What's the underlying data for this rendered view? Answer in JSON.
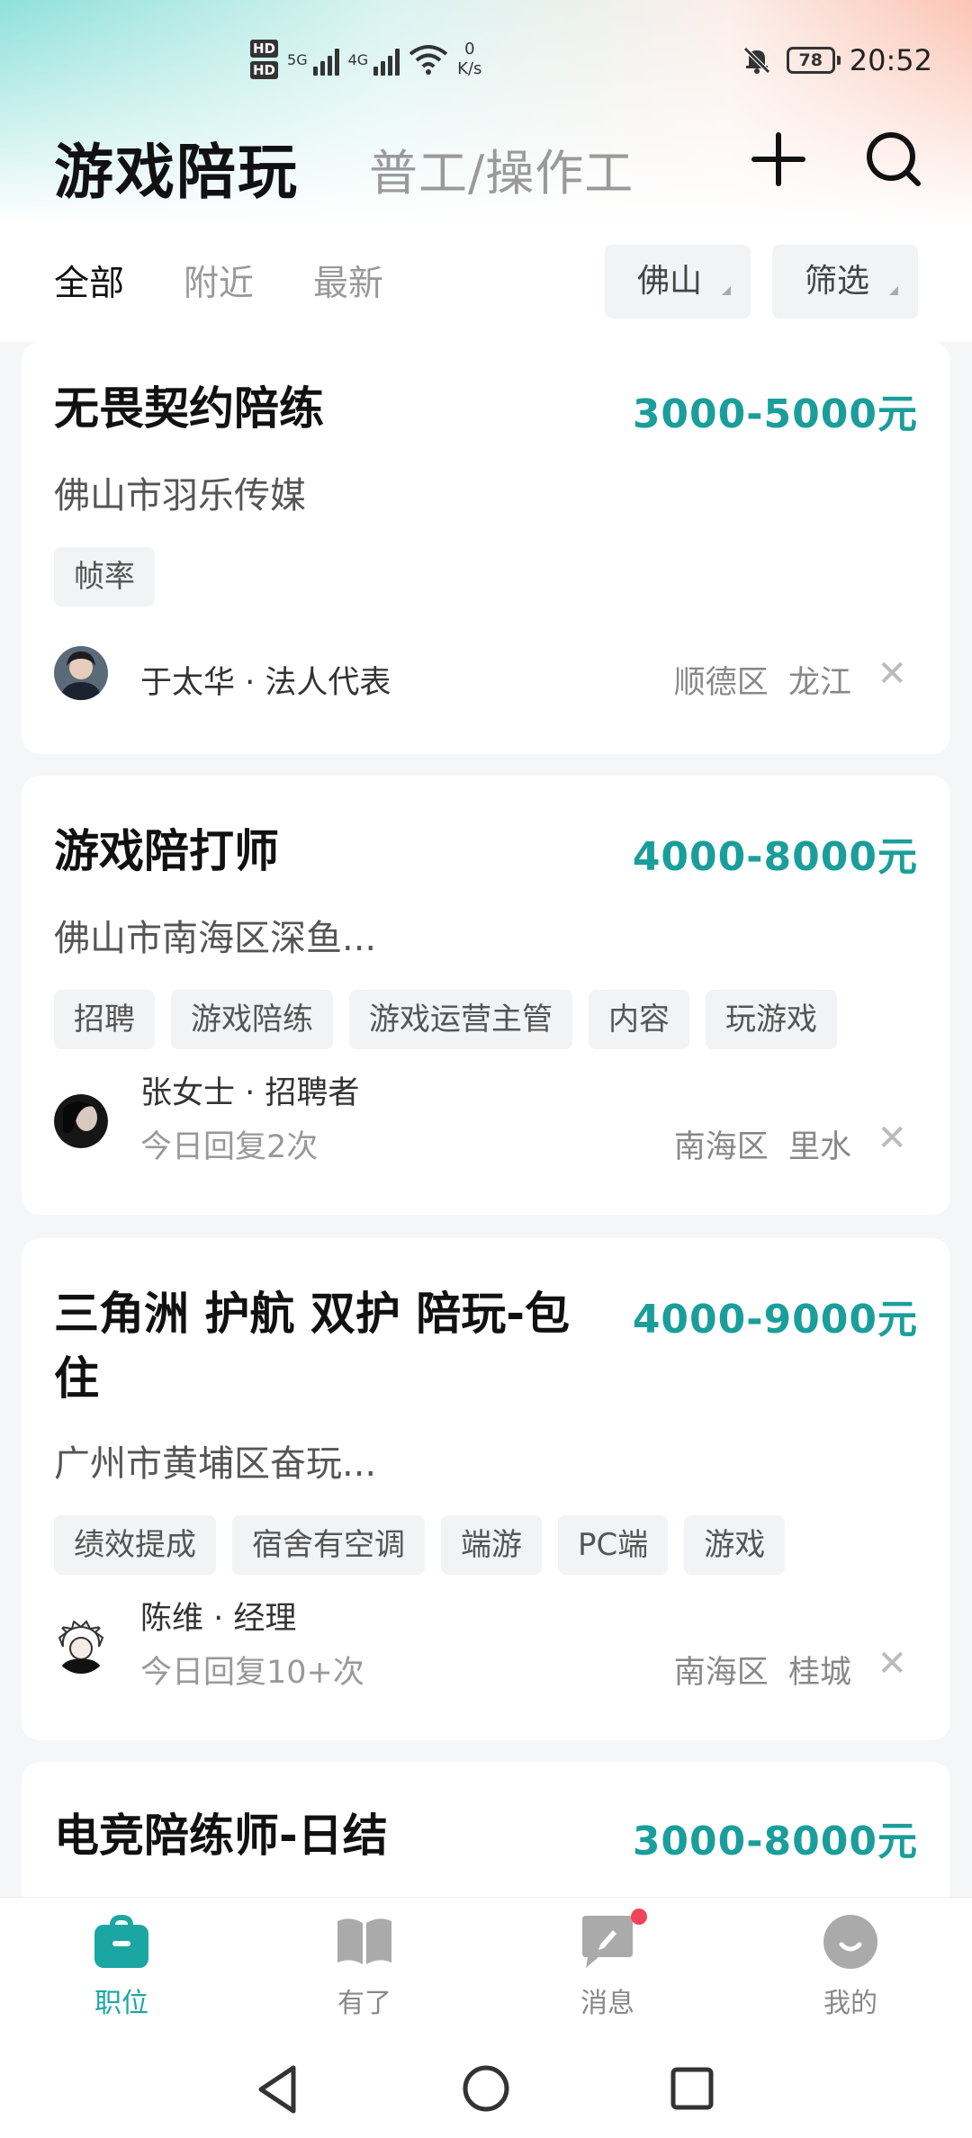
{
  "status_bar": {
    "hd1": "HD",
    "hd2": "HD",
    "net1": "5G",
    "net2": "4G",
    "speed_value": "0",
    "speed_unit": "K/s",
    "battery": "78",
    "time": "20:52"
  },
  "header": {
    "title": "游戏陪玩",
    "subtitle": "普工/操作工",
    "add_icon": "plus-icon",
    "search_icon": "search-icon"
  },
  "filters": {
    "tabs": [
      {
        "label": "全部",
        "active": true
      },
      {
        "label": "附近",
        "active": false
      },
      {
        "label": "最新",
        "active": false
      }
    ],
    "city": "佛山",
    "filter": "筛选"
  },
  "jobs": [
    {
      "title": "无畏契约陪练",
      "salary": "3000-5000元",
      "company": "佛山市羽乐传媒",
      "tags": [
        "帧率"
      ],
      "recruiter": "于太华 · 法人代表",
      "reply": "",
      "district": "顺德区",
      "area": "龙江"
    },
    {
      "title": "游戏陪打师",
      "salary": "4000-8000元",
      "company": "佛山市南海区深鱼...",
      "tags": [
        "招聘",
        "游戏陪练",
        "游戏运营主管",
        "内容",
        "玩游戏"
      ],
      "recruiter": "张女士 · 招聘者",
      "reply": "今日回复2次",
      "district": "南海区",
      "area": "里水"
    },
    {
      "title_line1": "三角洲 护航 双护 陪玩-包",
      "title_line2": "住",
      "salary": "4000-9000元",
      "company": "广州市黄埔区奋玩...",
      "tags": [
        "绩效提成",
        "宿舍有空调",
        "端游",
        "PC端",
        "游戏"
      ],
      "recruiter": "陈维 · 经理",
      "reply": "今日回复10+次",
      "district": "南海区",
      "area": "桂城"
    },
    {
      "title": "电竞陪练师-日结",
      "salary": "3000-8000元"
    }
  ],
  "tabbar": [
    {
      "label": "职位",
      "icon": "briefcase-icon",
      "active": true
    },
    {
      "label": "有了",
      "icon": "book-icon",
      "active": false
    },
    {
      "label": "消息",
      "icon": "message-icon",
      "active": false,
      "badge": true
    },
    {
      "label": "我的",
      "icon": "profile-icon",
      "active": false
    }
  ],
  "colors": {
    "accent": "#1a9e9b",
    "tab_active": "#1aa7a3",
    "badge": "#f0445a"
  }
}
